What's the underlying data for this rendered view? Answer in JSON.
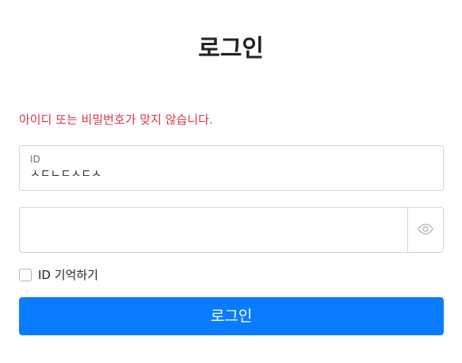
{
  "page": {
    "title": "로그인",
    "error_message": "아이디 또는 비밀번호가 맞지 않습니다."
  },
  "login_form": {
    "id_field": {
      "label": "ID",
      "value": "ㅅㄷㄴㄷㅅㄷㅅ"
    },
    "password_field": {
      "value": "",
      "toggle_icon": "eye-icon"
    },
    "remember_id": {
      "label": "ID 기억하기",
      "checked": false
    },
    "submit_label": "로그인"
  },
  "colors": {
    "error": "#dc3545",
    "primary": "#0a7cff",
    "border": "#ced4da"
  }
}
